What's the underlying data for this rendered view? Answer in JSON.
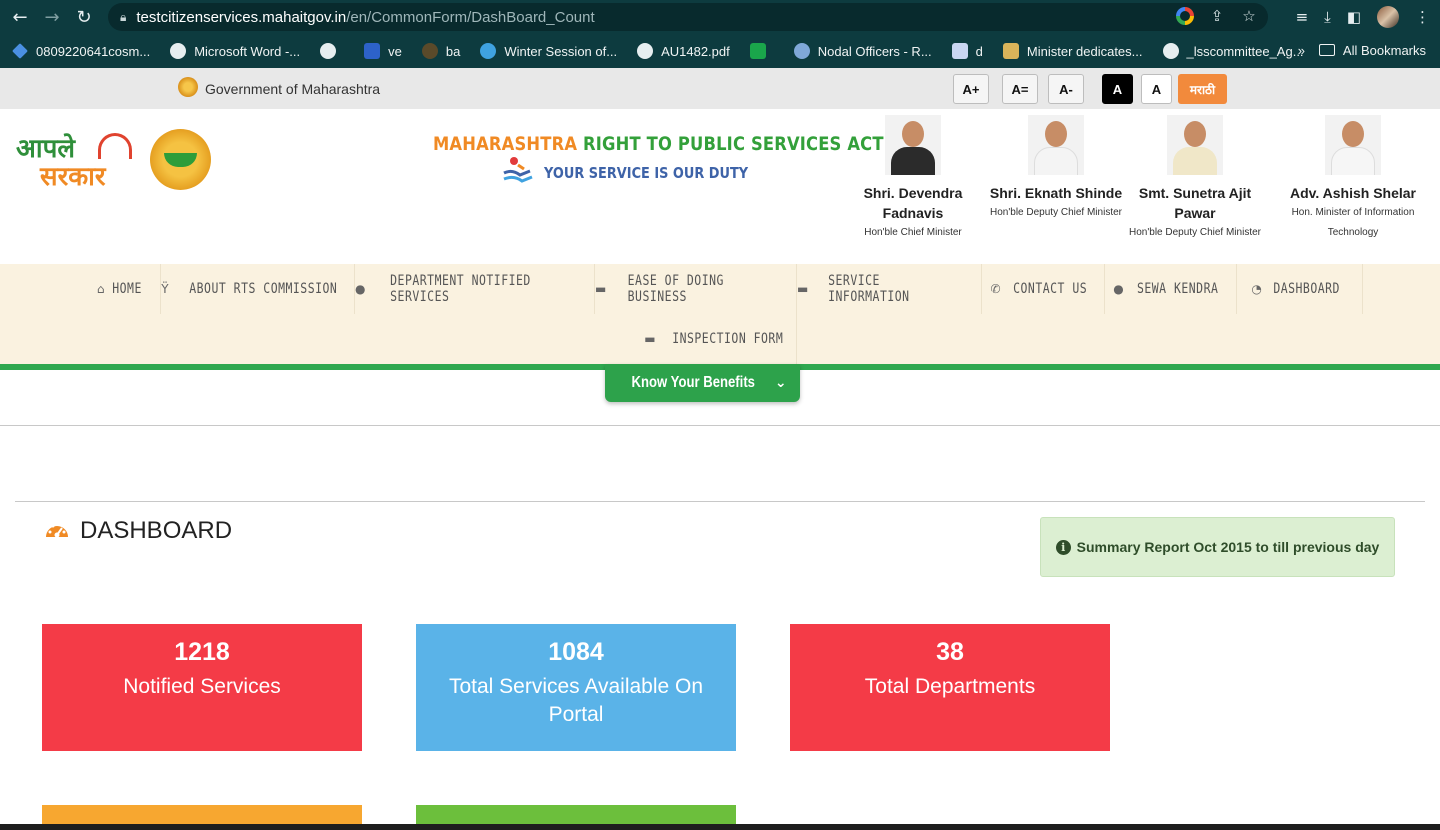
{
  "browser": {
    "url_host": "testcitizenservices.mahaitgov.in",
    "url_path": "/en/CommonForm/DashBoard_Count",
    "bookmarks": [
      {
        "label": "0809220641cosm..."
      },
      {
        "label": "Microsoft Word -..."
      },
      {
        "label": ""
      },
      {
        "label": "ve"
      },
      {
        "label": "ba"
      },
      {
        "label": "Winter Session of..."
      },
      {
        "label": "AU1482.pdf"
      },
      {
        "label": ""
      },
      {
        "label": "Nodal Officers - R..."
      },
      {
        "label": "d"
      },
      {
        "label": "Minister dedicates..."
      },
      {
        "label": "_lsscommittee_Ag..."
      }
    ],
    "more_bookmarks": "»",
    "all_bookmarks": "All Bookmarks"
  },
  "govbar": {
    "title": "Government of Maharashtra",
    "font_plus": "A+",
    "font_reset": "A=",
    "font_minus": "A-",
    "contrast_dark": "A",
    "contrast_light": "A",
    "language": "मराठी"
  },
  "header": {
    "act_orange": "MAHARASHTRA",
    "act_green": " RIGHT TO PUBLIC SERVICES ACT",
    "tagline": "YOUR SERVICE IS OUR DUTY",
    "logo_text_top": "आपले",
    "logo_text_bottom": "सरकार",
    "people": [
      {
        "name": "Shri. Devendra Fadnavis",
        "role": "Hon'ble Chief Minister"
      },
      {
        "name": "Shri. Eknath Shinde",
        "role": "Hon'ble Deputy Chief Minister"
      },
      {
        "name": "Smt. Sunetra Ajit Pawar",
        "role": "Hon'ble Deputy Chief Minister"
      },
      {
        "name": "Adv. Ashish Shelar",
        "role": "Hon. Minister of Information Technology"
      }
    ]
  },
  "nav": {
    "items": [
      {
        "label": "Home",
        "icon": "home-icon"
      },
      {
        "label": "About RTS Commission",
        "icon": "torch-icon"
      },
      {
        "label": "Department Notified Services",
        "icon": "user-icon"
      },
      {
        "label": "Ease of Doing Business",
        "icon": "briefcase-icon"
      },
      {
        "label": "Service Information",
        "icon": "briefcase-icon"
      },
      {
        "label": "Contact Us",
        "icon": "phone-icon"
      },
      {
        "label": "Sewa Kendra",
        "icon": "user-icon"
      },
      {
        "label": "Dashboard",
        "icon": "gauge-icon"
      },
      {
        "label": "Inspection Form",
        "icon": "briefcase-icon"
      }
    ],
    "benefits": "Know Your Benefits"
  },
  "dashboard": {
    "title": "DASHBOARD",
    "summary": "Summary Report Oct 2015 to till previous day",
    "cards": [
      {
        "value": "1218",
        "label": "Notified Services"
      },
      {
        "value": "1084",
        "label": "Total Services Available On Portal"
      },
      {
        "value": "38",
        "label": "Total Departments"
      }
    ]
  },
  "colors": {
    "card_red": "#f43b47",
    "card_blue": "#5ab3e8",
    "accent_green": "#2fa84f",
    "accent_orange": "#f08a24"
  }
}
